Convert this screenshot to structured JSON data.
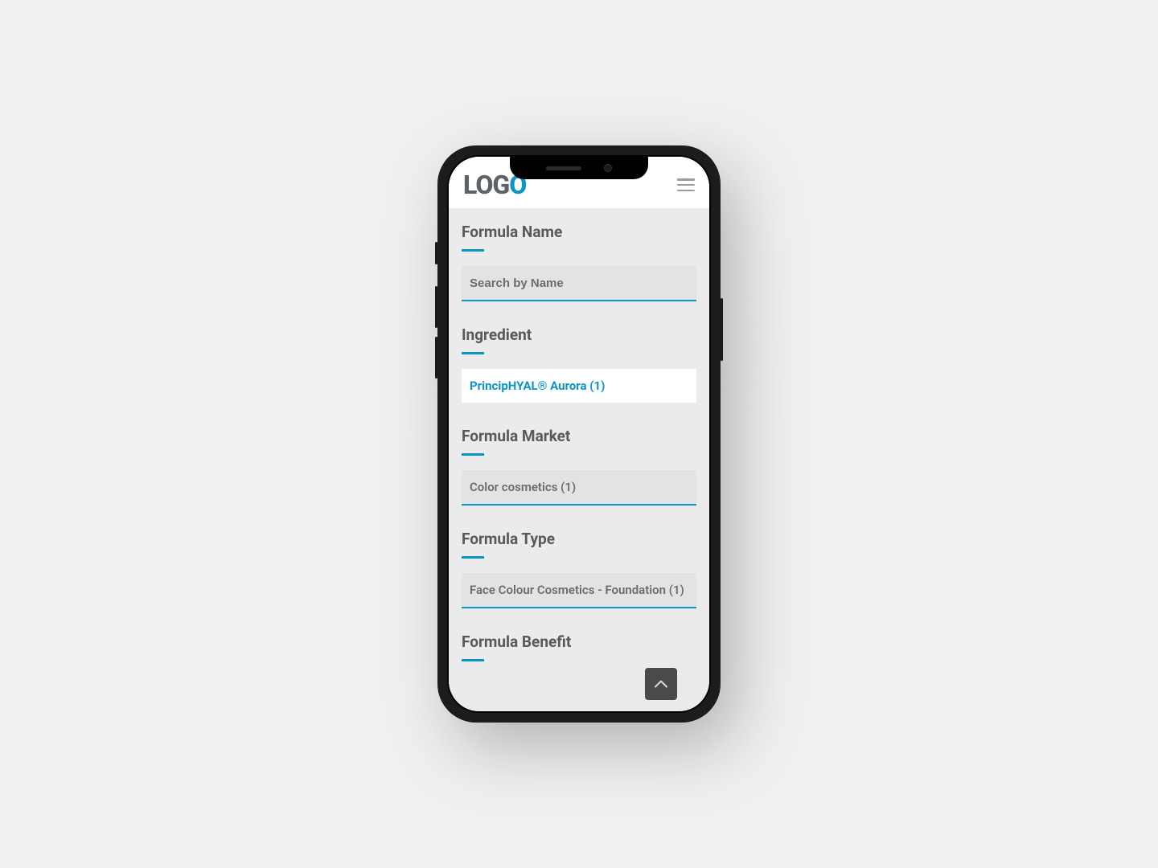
{
  "logo": {
    "part1": "LOG",
    "part2": "O"
  },
  "sections": {
    "formula_name": {
      "title": "Formula Name",
      "placeholder": "Search by Name"
    },
    "ingredient": {
      "title": "Ingredient",
      "value": "PrincipHYAL® Aurora (1)"
    },
    "formula_market": {
      "title": "Formula Market",
      "value": "Color cosmetics (1)"
    },
    "formula_type": {
      "title": "Formula Type",
      "value": "Face Colour Cosmetics - Foundation (1)"
    },
    "formula_benefit": {
      "title": "Formula Benefit"
    }
  },
  "colors": {
    "accent": "#0a96c7",
    "heading": "#57595d",
    "page_bg": "#f0f0f0",
    "content_bg": "#ebebeb"
  }
}
